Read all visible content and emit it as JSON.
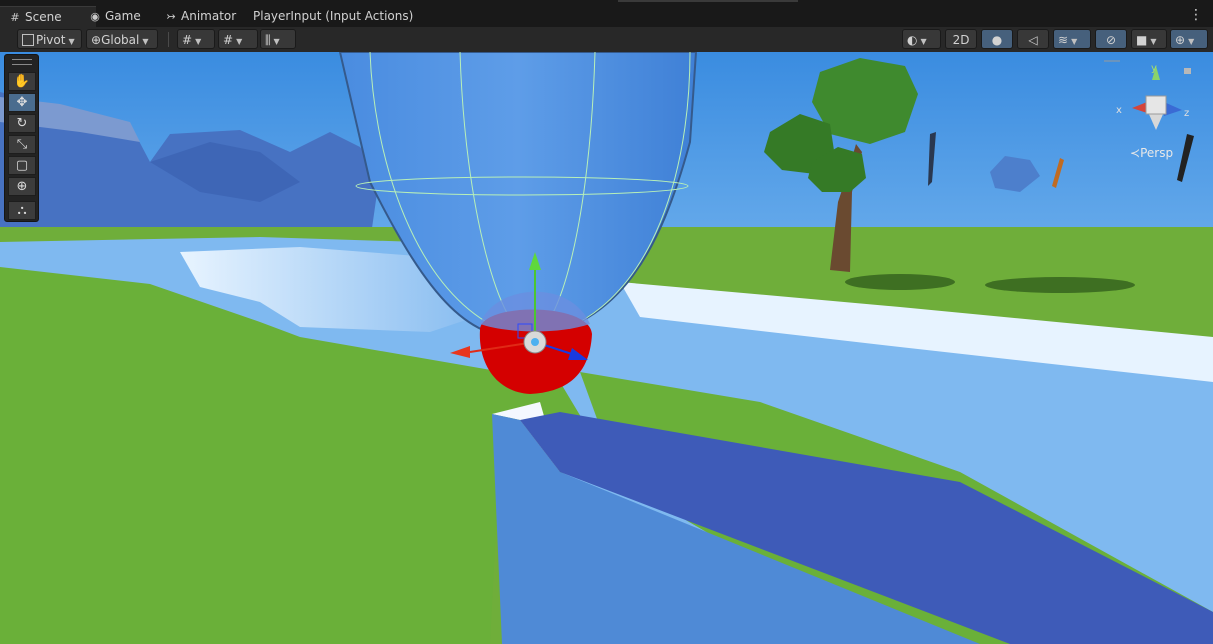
{
  "tabs": [
    {
      "label": "Scene",
      "icon": "grid-icon",
      "glyph": "#"
    },
    {
      "label": "Game",
      "icon": "gamepad-icon",
      "glyph": "◉"
    },
    {
      "label": "Animator",
      "icon": "animator-icon",
      "glyph": "↣"
    },
    {
      "label": "PlayerInput (Input Actions)",
      "icon": "",
      "glyph": ""
    }
  ],
  "toolbar": {
    "pivot_label": "Pivot",
    "global_label": "Global",
    "mode_2d_label": "2D"
  },
  "scene": {
    "persp_label": "Persp",
    "gizmo_x": "x",
    "gizmo_y": "y",
    "gizmo_z": "z"
  },
  "colors": {
    "sky_top": "#3d8fe0",
    "sky_bottom": "#c8e6ff",
    "grass": "#6fae3a",
    "water": "#7fb9f0",
    "capsule": "#4d8fe0",
    "player_ball": "#d40000",
    "active_tool": "#4a6c8e"
  }
}
